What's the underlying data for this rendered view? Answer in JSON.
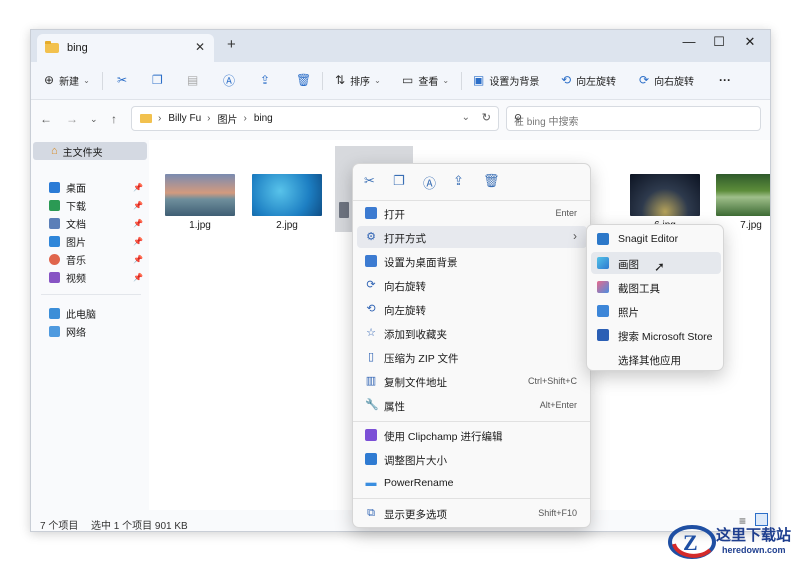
{
  "window": {
    "tab_title": "bing",
    "tab_close": "✕",
    "new_tab": "+",
    "controls": {
      "minimize": "—",
      "maximize": "☐",
      "close": "✕"
    }
  },
  "toolbar": {
    "new_label": "新建",
    "sort_label": "排序",
    "view_label": "查看",
    "set_bg_label": "设置为背景",
    "rotate_left_label": "向左旋转",
    "rotate_right_label": "向右旋转",
    "more_label": "···"
  },
  "address": {
    "crumbs": [
      "Billy Fu",
      "图片",
      "bing"
    ],
    "search_placeholder": "在 bing 中搜索"
  },
  "sidebar": {
    "home": "主文件夹",
    "quick": [
      {
        "label": "桌面",
        "color": "#2b7bd6"
      },
      {
        "label": "下载",
        "color": "#2b9a54"
      },
      {
        "label": "文档",
        "color": "#5b7fb8"
      },
      {
        "label": "图片",
        "color": "#2f86d9"
      },
      {
        "label": "音乐",
        "color": "#e0654c"
      },
      {
        "label": "视频",
        "color": "#8754c4"
      }
    ],
    "this_pc": "此电脑",
    "network": "网络"
  },
  "files": [
    {
      "name": "1.jpg"
    },
    {
      "name": "2.jpg"
    },
    {
      "name": "6.jpg"
    },
    {
      "name": "7.jpg"
    }
  ],
  "status": {
    "count": "7 个项目",
    "selected": "选中 1 个项目  901 KB"
  },
  "context_menu": {
    "items": [
      {
        "label": "打开",
        "shortcut": "Enter"
      },
      {
        "label": "打开方式",
        "shortcut": "›"
      },
      {
        "label": "设置为桌面背景",
        "shortcut": ""
      },
      {
        "label": "向右旋转",
        "shortcut": ""
      },
      {
        "label": "向左旋转",
        "shortcut": ""
      },
      {
        "label": "添加到收藏夹",
        "shortcut": ""
      },
      {
        "label": "压缩为 ZIP 文件",
        "shortcut": ""
      },
      {
        "label": "复制文件地址",
        "shortcut": "Ctrl+Shift+C"
      },
      {
        "label": "属性",
        "shortcut": "Alt+Enter"
      },
      {
        "label": "使用 Clipchamp 进行编辑",
        "shortcut": ""
      },
      {
        "label": "调整图片大小",
        "shortcut": ""
      },
      {
        "label": "PowerRename",
        "shortcut": ""
      },
      {
        "label": "显示更多选项",
        "shortcut": "Shift+F10"
      }
    ]
  },
  "open_with": {
    "items": [
      {
        "label": "Snagit Editor"
      },
      {
        "label": "画图"
      },
      {
        "label": "截图工具"
      },
      {
        "label": "照片"
      },
      {
        "label": "搜索 Microsoft Store"
      },
      {
        "label": "选择其他应用"
      }
    ]
  },
  "watermark": {
    "title": "这里下载站",
    "url": "heredown.com"
  }
}
